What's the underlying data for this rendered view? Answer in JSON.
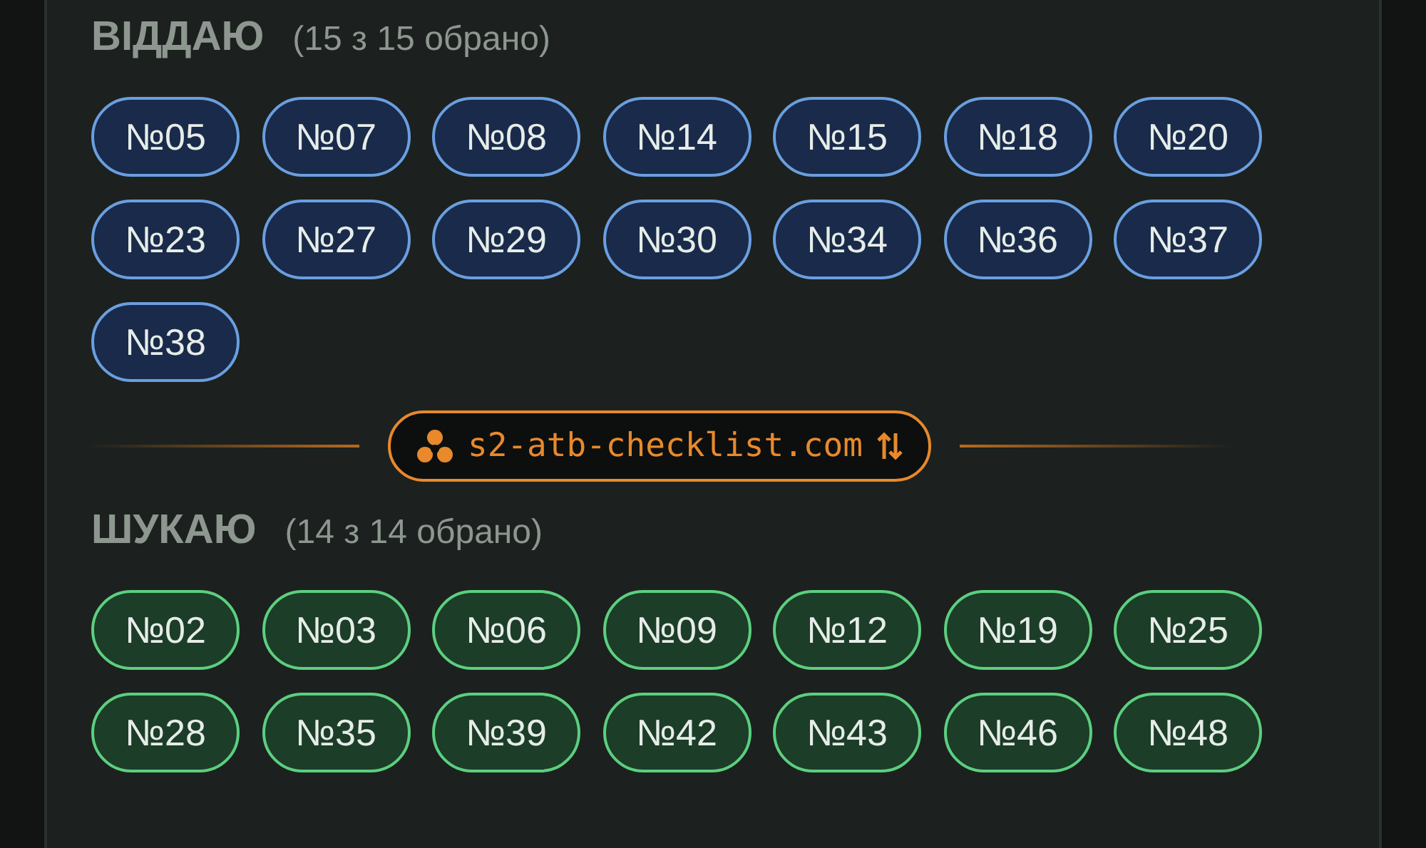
{
  "sections": [
    {
      "kind": "give",
      "title": "ВІДДАЮ",
      "count": "(15 з 15 обрано)",
      "items": [
        "№05",
        "№07",
        "№08",
        "№14",
        "№15",
        "№18",
        "№20",
        "№23",
        "№27",
        "№29",
        "№30",
        "№34",
        "№36",
        "№37",
        "№38"
      ]
    },
    {
      "kind": "link",
      "text": "s2-atb-checklist.com"
    },
    {
      "kind": "seek",
      "title": "ШУКАЮ",
      "count": "(14 з 14 обрано)",
      "items": [
        "№02",
        "№03",
        "№06",
        "№09",
        "№12",
        "№19",
        "№25",
        "№28",
        "№35",
        "№39",
        "№42",
        "№43",
        "№46",
        "№48"
      ]
    }
  ]
}
